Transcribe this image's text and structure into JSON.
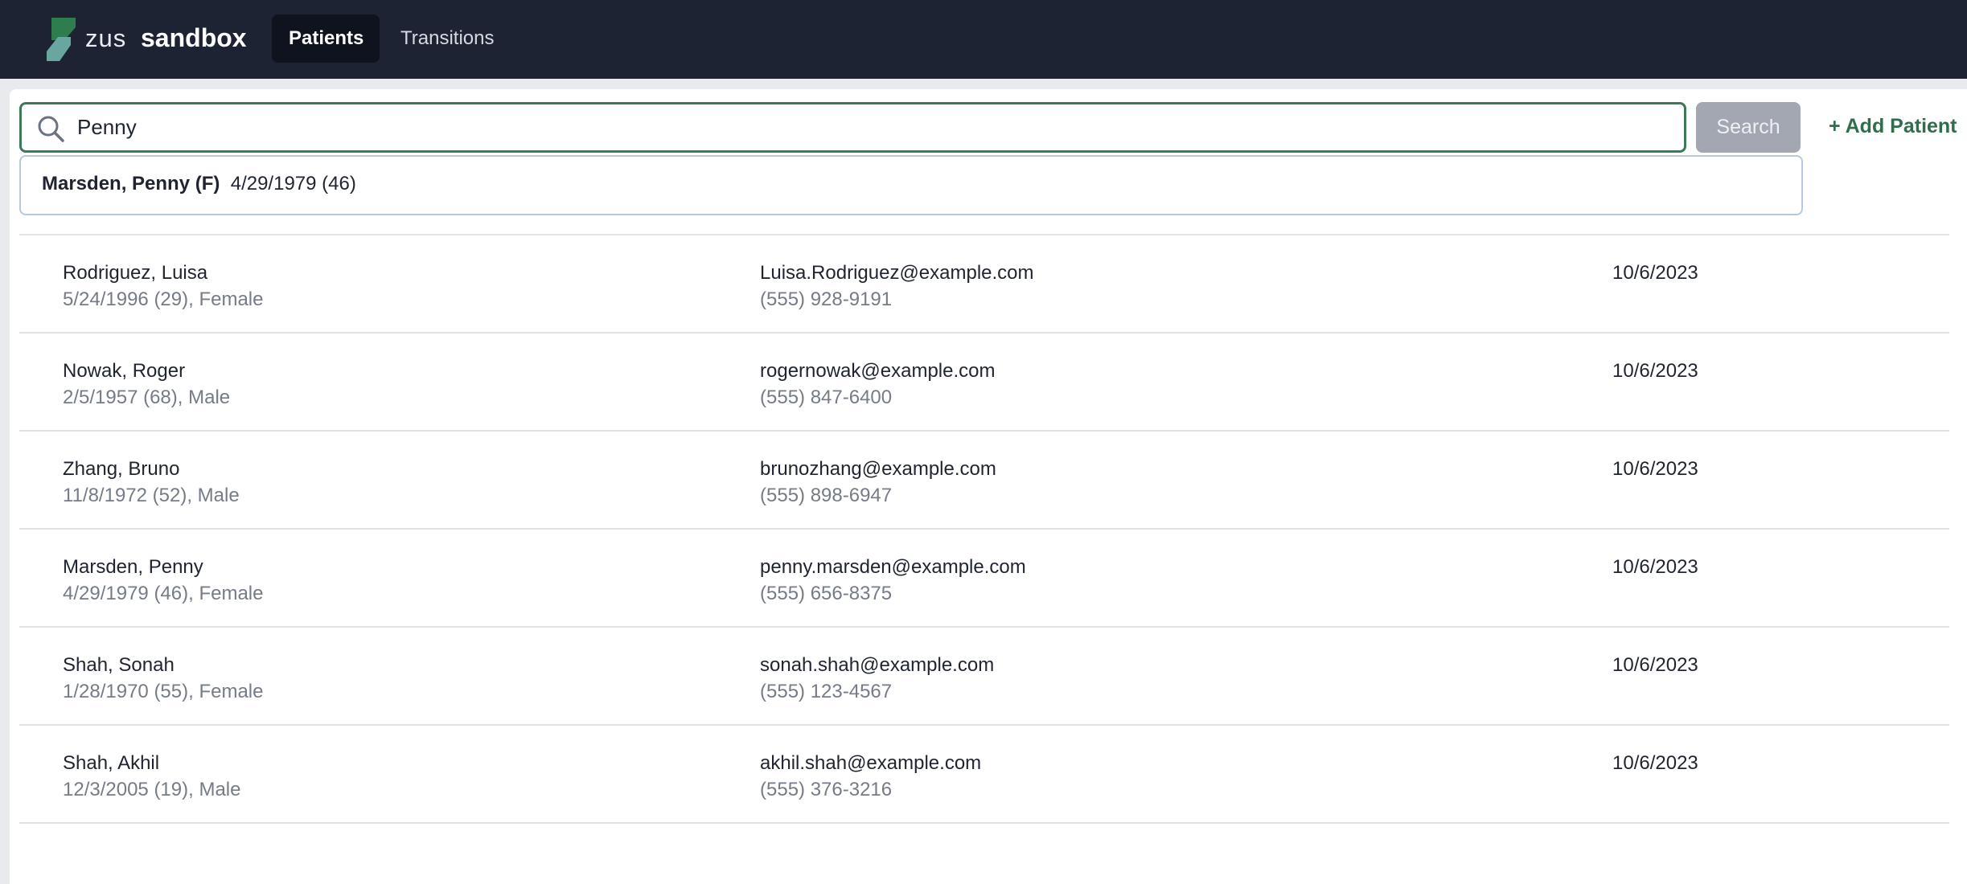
{
  "app": {
    "logo_word": "zus",
    "name": "sandbox",
    "tabs": [
      {
        "label": "Patients"
      },
      {
        "label": "Transitions"
      }
    ]
  },
  "search": {
    "value": "Penny",
    "button_label": "Search",
    "add_patient_label": "+ Add Patient"
  },
  "dropdown": {
    "items": [
      {
        "name": "Marsden, Penny (F)",
        "dob": "4/29/1979 (46)"
      }
    ]
  },
  "patients": [
    {
      "name": "Rodriguez, Luisa",
      "details": "5/24/1996 (29), Female",
      "email": "Luisa.Rodriguez@example.com",
      "phone": "(555) 928-9191",
      "date": "10/6/2023"
    },
    {
      "name": "Nowak, Roger",
      "details": "2/5/1957 (68), Male",
      "email": "rogernowak@example.com",
      "phone": "(555) 847-6400",
      "date": "10/6/2023"
    },
    {
      "name": "Zhang, Bruno",
      "details": "11/8/1972 (52), Male",
      "email": "brunozhang@example.com",
      "phone": "(555) 898-6947",
      "date": "10/6/2023"
    },
    {
      "name": "Marsden, Penny",
      "details": "4/29/1979 (46), Female",
      "email": "penny.marsden@example.com",
      "phone": "(555) 656-8375",
      "date": "10/6/2023"
    },
    {
      "name": "Shah, Sonah",
      "details": "1/28/1970 (55), Female",
      "email": "sonah.shah@example.com",
      "phone": "(555) 123-4567",
      "date": "10/6/2023"
    },
    {
      "name": "Shah, Akhil",
      "details": "12/3/2005 (19), Male",
      "email": "akhil.shah@example.com",
      "phone": "(555) 376-3216",
      "date": "10/6/2023"
    }
  ],
  "colors": {
    "nav_bg": "#1e2334",
    "accent": "#3b7a57",
    "logo_teal": "#5b9e95",
    "logo_green": "#2f7d4f"
  }
}
